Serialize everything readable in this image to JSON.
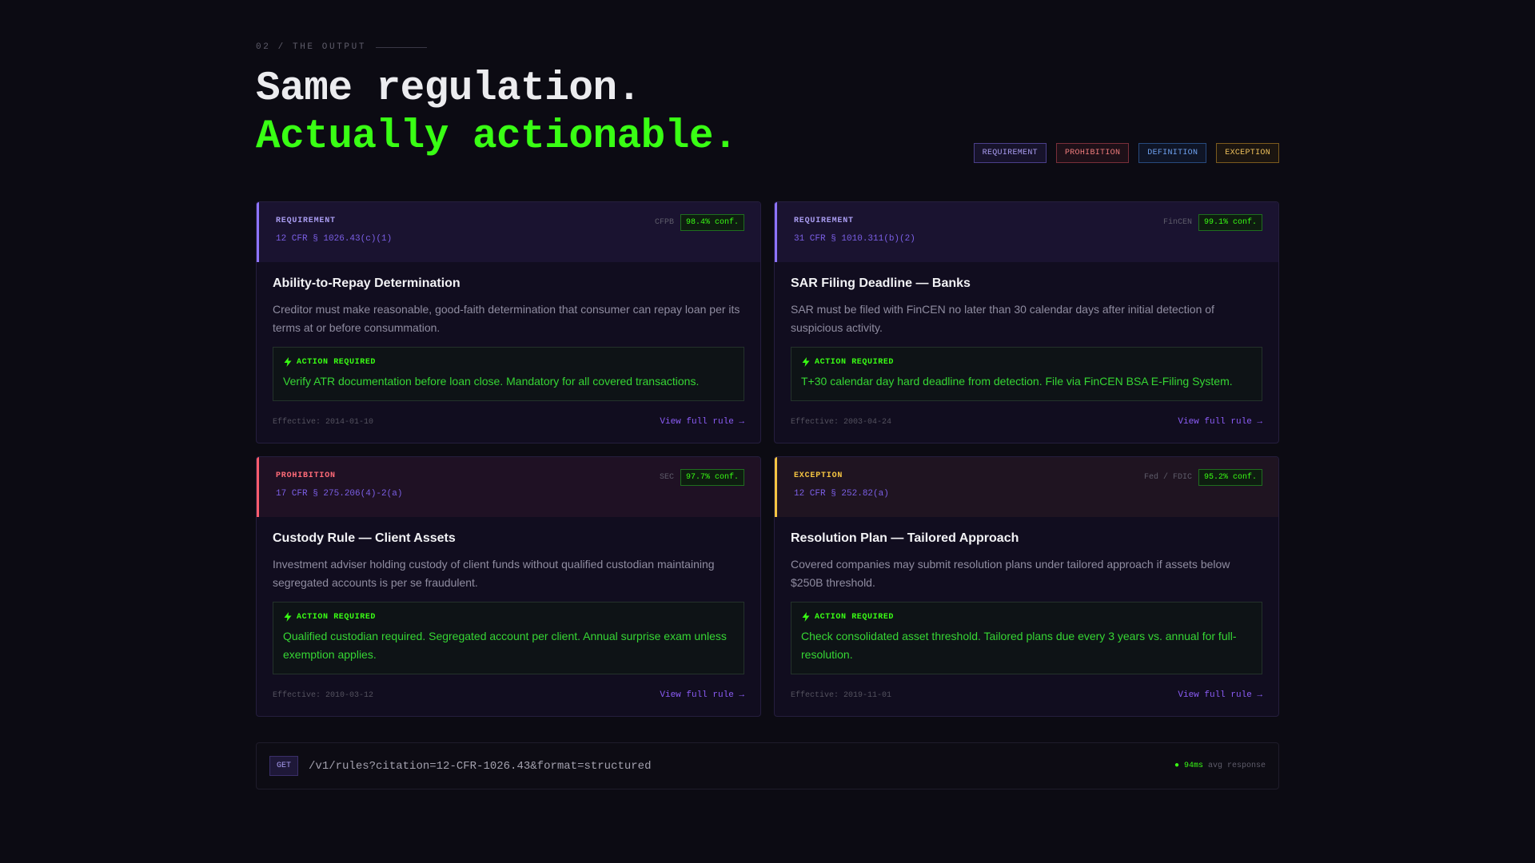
{
  "section": {
    "eyebrow": "02 / THE OUTPUT"
  },
  "headline": {
    "line1": "Same regulation.",
    "line2": "Actually actionable."
  },
  "legend": {
    "requirement": "REQUIREMENT",
    "prohibition": "PROHIBITION",
    "definition": "DEFINITION",
    "exception": "EXCEPTION"
  },
  "colors": {
    "requirement": "#8e74ff",
    "prohibition": "#ff5c6c",
    "definition": "#6fa2f0",
    "exception": "#f5c542",
    "action_green": "#39ff14",
    "background": "#0c0b13"
  },
  "cards": [
    {
      "type": "REQUIREMENT",
      "citation": "12 CFR § 1026.43(c)(1)",
      "agency": "CFPB",
      "confidence": "98.4% conf.",
      "title": "Ability-to-Repay Determination",
      "description": "Creditor must make reasonable, good-faith determination that consumer can repay loan per its terms at or before consummation.",
      "action_label": "ACTION REQUIRED",
      "action_icon": "bolt-icon",
      "action_text": "Verify ATR documentation before loan close. Mandatory for all covered transactions.",
      "effective": "Effective: 2014-01-10",
      "link": "View full rule →"
    },
    {
      "type": "REQUIREMENT",
      "citation": "31 CFR § 1010.311(b)(2)",
      "agency": "FinCEN",
      "confidence": "99.1% conf.",
      "title": "SAR Filing Deadline — Banks",
      "description": "SAR must be filed with FinCEN no later than 30 calendar days after initial detection of suspicious activity.",
      "action_label": "ACTION REQUIRED",
      "action_icon": "bolt-icon",
      "action_text": "T+30 calendar day hard deadline from detection. File via FinCEN BSA E-Filing System.",
      "effective": "Effective: 2003-04-24",
      "link": "View full rule →"
    },
    {
      "type": "PROHIBITION",
      "citation": "17 CFR § 275.206(4)-2(a)",
      "agency": "SEC",
      "confidence": "97.7% conf.",
      "title": "Custody Rule — Client Assets",
      "description": "Investment adviser holding custody of client funds without qualified custodian maintaining segregated accounts is per se fraudulent.",
      "action_label": "ACTION REQUIRED",
      "action_icon": "bolt-icon",
      "action_text": "Qualified custodian required. Segregated account per client. Annual surprise exam unless exemption applies.",
      "effective": "Effective: 2010-03-12",
      "link": "View full rule →"
    },
    {
      "type": "EXCEPTION",
      "citation": "12 CFR § 252.82(a)",
      "agency": "Fed / FDIC",
      "confidence": "95.2% conf.",
      "title": "Resolution Plan — Tailored Approach",
      "description": "Covered companies may submit resolution plans under tailored approach if assets below $250B threshold.",
      "action_label": "ACTION REQUIRED",
      "action_icon": "bolt-icon",
      "action_text": "Check consolidated asset threshold. Tailored plans due every 3 years vs. annual for full-resolution.",
      "effective": "Effective: 2019-11-01",
      "link": "View full rule →"
    }
  ],
  "api": {
    "method": "GET",
    "endpoint": "/v1/rules?citation=12-CFR-1026.43&format=structured",
    "latency": "● 94ms",
    "latency_label": "avg response"
  }
}
